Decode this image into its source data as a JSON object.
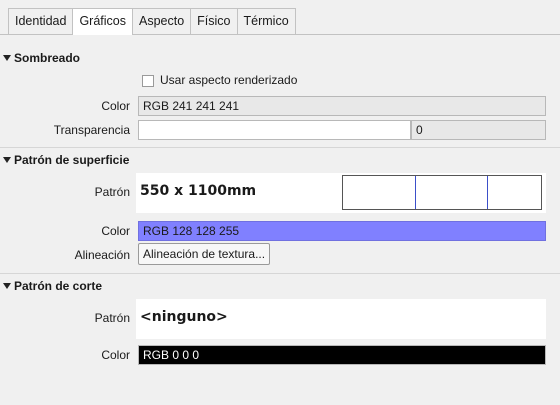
{
  "tabs": [
    "Identidad",
    "Gráficos",
    "Aspecto",
    "Físico",
    "Térmico"
  ],
  "active_tab": "Gráficos",
  "sombreado": {
    "title": "Sombreado",
    "use_render_label": "Usar aspecto renderizado",
    "use_render_checked": false,
    "color_label": "Color",
    "color_value": "RGB 241 241 241",
    "transparency_label": "Transparencia",
    "transparency_value": "0"
  },
  "surface": {
    "title": "Patrón de superficie",
    "pattern_label": "Patrón",
    "pattern_value": "550 x 1100mm",
    "color_label": "Color",
    "color_value": "RGB 128 128 255",
    "color_hex": "#8080ff",
    "align_label": "Alineación",
    "align_button": "Alineación de textura..."
  },
  "cut": {
    "title": "Patrón de corte",
    "pattern_label": "Patrón",
    "pattern_value": "<ninguno>",
    "color_label": "Color",
    "color_value": "RGB 0 0 0",
    "color_hex": "#000000"
  }
}
